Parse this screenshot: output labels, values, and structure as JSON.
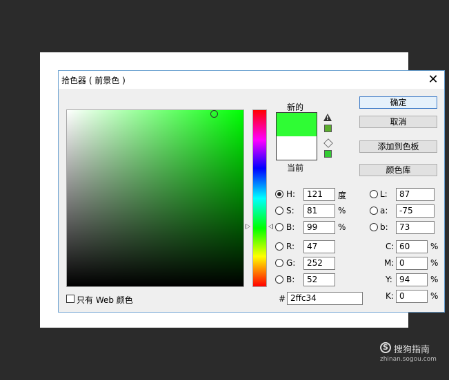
{
  "dialog": {
    "title": "拾色器 ( 前景色 )",
    "close_glyph": "✕"
  },
  "swatch": {
    "new_label": "新的",
    "current_label": "当前",
    "new_color": "#2ffc34",
    "current_color": "#ffffff",
    "warning_glyph": "!",
    "gamut_warning_color": "#5bae2e",
    "web_safe_color": "#33cc33"
  },
  "buttons": {
    "ok": "确定",
    "cancel": "取消",
    "add_to_swatches": "添加到色板",
    "color_libraries": "颜色库"
  },
  "hsb": {
    "h_label": "H:",
    "h_value": "121",
    "h_unit": "度",
    "s_label": "S:",
    "s_value": "81",
    "s_unit": "%",
    "b_label": "B:",
    "b_value": "99",
    "b_unit": "%"
  },
  "rgb": {
    "r_label": "R:",
    "r_value": "47",
    "g_label": "G:",
    "g_value": "252",
    "b_label": "B:",
    "b_value": "52"
  },
  "lab": {
    "l_label": "L:",
    "l_value": "87",
    "a_label": "a:",
    "a_value": "-75",
    "b_label": "b:",
    "b_value": "73"
  },
  "cmyk": {
    "c_label": "C:",
    "c_value": "60",
    "c_unit": "%",
    "m_label": "M:",
    "m_value": "0",
    "m_unit": "%",
    "y_label": "Y:",
    "y_value": "94",
    "y_unit": "%",
    "k_label": "K:",
    "k_value": "0",
    "k_unit": "%"
  },
  "hex": {
    "label": "#",
    "value": "2ffc34"
  },
  "web_only": {
    "label": "只有 Web 颜色",
    "checked": false
  },
  "field_color": {
    "hue": "#00ff04"
  },
  "watermark": {
    "logo_glyph": "S",
    "text": "搜狗指南",
    "url": "zhinan.sogou.com"
  }
}
